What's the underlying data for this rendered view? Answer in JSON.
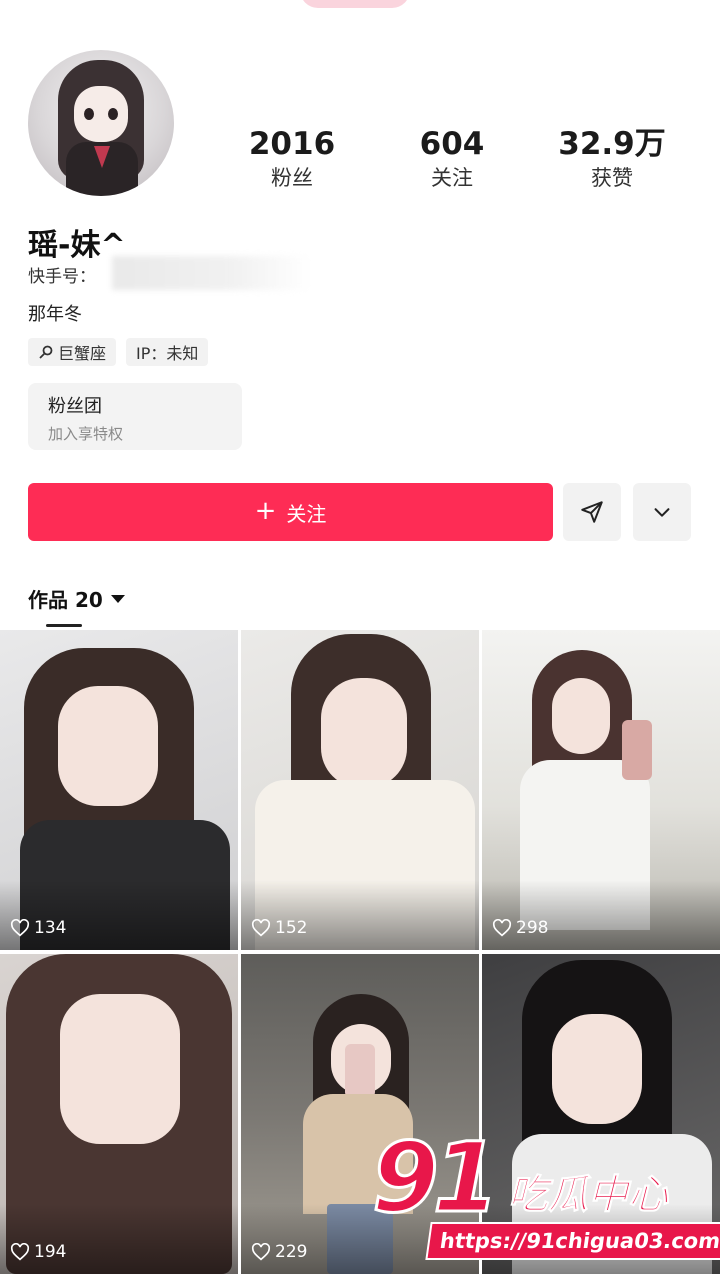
{
  "profile": {
    "name": "瑶-妹^",
    "kuaishou_label": "快手号：",
    "bio": "那年冬",
    "tags": [
      {
        "icon": "search-icon",
        "label": "巨蟹座"
      },
      {
        "icon": "",
        "label": "IP：未知"
      }
    ]
  },
  "stats": {
    "fans": {
      "value": "2016",
      "label": "粉丝"
    },
    "following": {
      "value": "604",
      "label": "关注"
    },
    "likes": {
      "value": "32.9万",
      "label": "获赞"
    }
  },
  "fanclub": {
    "title": "粉丝团",
    "subtitle": "加入享特权"
  },
  "actions": {
    "follow_label": "关注",
    "follow_icon": "plus-icon",
    "share_icon": "send-icon",
    "more_icon": "chevron-down-icon"
  },
  "works": {
    "label": "作品 20"
  },
  "posts": [
    {
      "likes": "134"
    },
    {
      "likes": "152"
    },
    {
      "likes": "298"
    },
    {
      "likes": "194"
    },
    {
      "likes": "229"
    },
    {
      "likes": ""
    }
  ],
  "watermark": {
    "brand_number": "91",
    "brand_text": "吃瓜中心",
    "url": "https://91chigua03.com"
  },
  "colors": {
    "accent": "#fe2c55",
    "watermark": "#e8174a"
  }
}
